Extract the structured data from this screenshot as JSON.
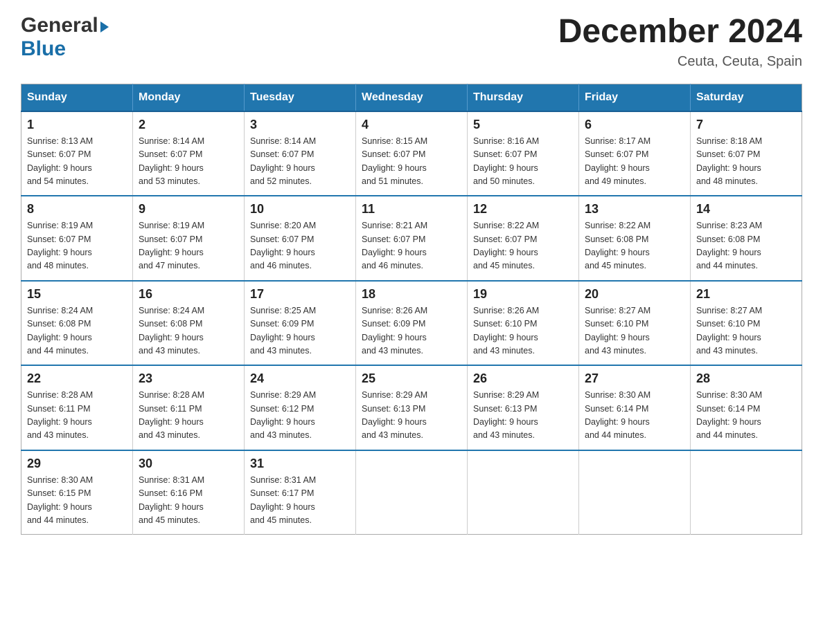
{
  "header": {
    "logo_general": "General",
    "logo_blue": "Blue",
    "month_title": "December 2024",
    "location": "Ceuta, Ceuta, Spain"
  },
  "days_of_week": [
    "Sunday",
    "Monday",
    "Tuesday",
    "Wednesday",
    "Thursday",
    "Friday",
    "Saturday"
  ],
  "weeks": [
    [
      {
        "day": "1",
        "sunrise": "8:13 AM",
        "sunset": "6:07 PM",
        "daylight": "9 hours and 54 minutes."
      },
      {
        "day": "2",
        "sunrise": "8:14 AM",
        "sunset": "6:07 PM",
        "daylight": "9 hours and 53 minutes."
      },
      {
        "day": "3",
        "sunrise": "8:14 AM",
        "sunset": "6:07 PM",
        "daylight": "9 hours and 52 minutes."
      },
      {
        "day": "4",
        "sunrise": "8:15 AM",
        "sunset": "6:07 PM",
        "daylight": "9 hours and 51 minutes."
      },
      {
        "day": "5",
        "sunrise": "8:16 AM",
        "sunset": "6:07 PM",
        "daylight": "9 hours and 50 minutes."
      },
      {
        "day": "6",
        "sunrise": "8:17 AM",
        "sunset": "6:07 PM",
        "daylight": "9 hours and 49 minutes."
      },
      {
        "day": "7",
        "sunrise": "8:18 AM",
        "sunset": "6:07 PM",
        "daylight": "9 hours and 48 minutes."
      }
    ],
    [
      {
        "day": "8",
        "sunrise": "8:19 AM",
        "sunset": "6:07 PM",
        "daylight": "9 hours and 48 minutes."
      },
      {
        "day": "9",
        "sunrise": "8:19 AM",
        "sunset": "6:07 PM",
        "daylight": "9 hours and 47 minutes."
      },
      {
        "day": "10",
        "sunrise": "8:20 AM",
        "sunset": "6:07 PM",
        "daylight": "9 hours and 46 minutes."
      },
      {
        "day": "11",
        "sunrise": "8:21 AM",
        "sunset": "6:07 PM",
        "daylight": "9 hours and 46 minutes."
      },
      {
        "day": "12",
        "sunrise": "8:22 AM",
        "sunset": "6:07 PM",
        "daylight": "9 hours and 45 minutes."
      },
      {
        "day": "13",
        "sunrise": "8:22 AM",
        "sunset": "6:08 PM",
        "daylight": "9 hours and 45 minutes."
      },
      {
        "day": "14",
        "sunrise": "8:23 AM",
        "sunset": "6:08 PM",
        "daylight": "9 hours and 44 minutes."
      }
    ],
    [
      {
        "day": "15",
        "sunrise": "8:24 AM",
        "sunset": "6:08 PM",
        "daylight": "9 hours and 44 minutes."
      },
      {
        "day": "16",
        "sunrise": "8:24 AM",
        "sunset": "6:08 PM",
        "daylight": "9 hours and 43 minutes."
      },
      {
        "day": "17",
        "sunrise": "8:25 AM",
        "sunset": "6:09 PM",
        "daylight": "9 hours and 43 minutes."
      },
      {
        "day": "18",
        "sunrise": "8:26 AM",
        "sunset": "6:09 PM",
        "daylight": "9 hours and 43 minutes."
      },
      {
        "day": "19",
        "sunrise": "8:26 AM",
        "sunset": "6:10 PM",
        "daylight": "9 hours and 43 minutes."
      },
      {
        "day": "20",
        "sunrise": "8:27 AM",
        "sunset": "6:10 PM",
        "daylight": "9 hours and 43 minutes."
      },
      {
        "day": "21",
        "sunrise": "8:27 AM",
        "sunset": "6:10 PM",
        "daylight": "9 hours and 43 minutes."
      }
    ],
    [
      {
        "day": "22",
        "sunrise": "8:28 AM",
        "sunset": "6:11 PM",
        "daylight": "9 hours and 43 minutes."
      },
      {
        "day": "23",
        "sunrise": "8:28 AM",
        "sunset": "6:11 PM",
        "daylight": "9 hours and 43 minutes."
      },
      {
        "day": "24",
        "sunrise": "8:29 AM",
        "sunset": "6:12 PM",
        "daylight": "9 hours and 43 minutes."
      },
      {
        "day": "25",
        "sunrise": "8:29 AM",
        "sunset": "6:13 PM",
        "daylight": "9 hours and 43 minutes."
      },
      {
        "day": "26",
        "sunrise": "8:29 AM",
        "sunset": "6:13 PM",
        "daylight": "9 hours and 43 minutes."
      },
      {
        "day": "27",
        "sunrise": "8:30 AM",
        "sunset": "6:14 PM",
        "daylight": "9 hours and 44 minutes."
      },
      {
        "day": "28",
        "sunrise": "8:30 AM",
        "sunset": "6:14 PM",
        "daylight": "9 hours and 44 minutes."
      }
    ],
    [
      {
        "day": "29",
        "sunrise": "8:30 AM",
        "sunset": "6:15 PM",
        "daylight": "9 hours and 44 minutes."
      },
      {
        "day": "30",
        "sunrise": "8:31 AM",
        "sunset": "6:16 PM",
        "daylight": "9 hours and 45 minutes."
      },
      {
        "day": "31",
        "sunrise": "8:31 AM",
        "sunset": "6:17 PM",
        "daylight": "9 hours and 45 minutes."
      },
      null,
      null,
      null,
      null
    ]
  ],
  "labels": {
    "sunrise": "Sunrise:",
    "sunset": "Sunset:",
    "daylight": "Daylight:"
  }
}
